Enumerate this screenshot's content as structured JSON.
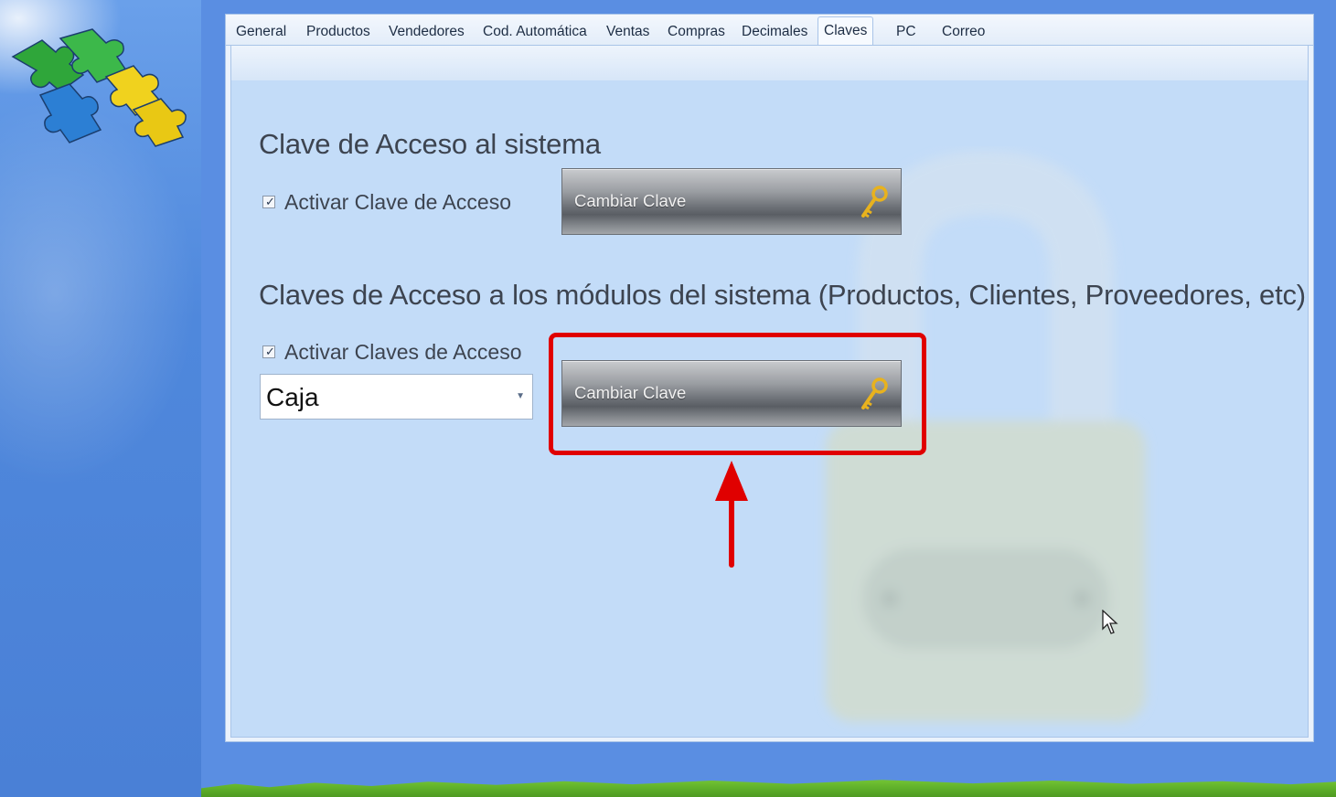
{
  "tabs": [
    {
      "label": "General",
      "active": false
    },
    {
      "label": "Productos",
      "active": false
    },
    {
      "label": "Vendedores",
      "active": false
    },
    {
      "label": "Cod. Automática",
      "active": false
    },
    {
      "label": "Ventas",
      "active": false
    },
    {
      "label": "Compras",
      "active": false
    },
    {
      "label": "Decimales",
      "active": false
    },
    {
      "label": "Claves",
      "active": true
    },
    {
      "label": "PC",
      "active": false
    },
    {
      "label": "Correo",
      "active": false
    }
  ],
  "system_access": {
    "heading": "Clave de Acceso al sistema",
    "checkbox_label": "Activar Clave de Acceso",
    "checked": true,
    "button_label": "Cambiar Clave",
    "button_icon": "key-icon"
  },
  "module_access": {
    "heading": "Claves de Acceso a los módulos del sistema (Productos, Clientes, Proveedores, etc)",
    "checkbox_label": "Activar Claves de Acceso",
    "checked": true,
    "dropdown_value": "Caja",
    "button_label": "Cambiar Clave",
    "button_icon": "key-icon"
  },
  "colors": {
    "highlight": "#e00000",
    "panel_background": "#c3dcf8",
    "sidebar": "#5b8fe0"
  },
  "icons": {
    "logo": "puzzle-logo-icon",
    "background": "padlock-icon",
    "cursor": "mouse-cursor-icon"
  }
}
